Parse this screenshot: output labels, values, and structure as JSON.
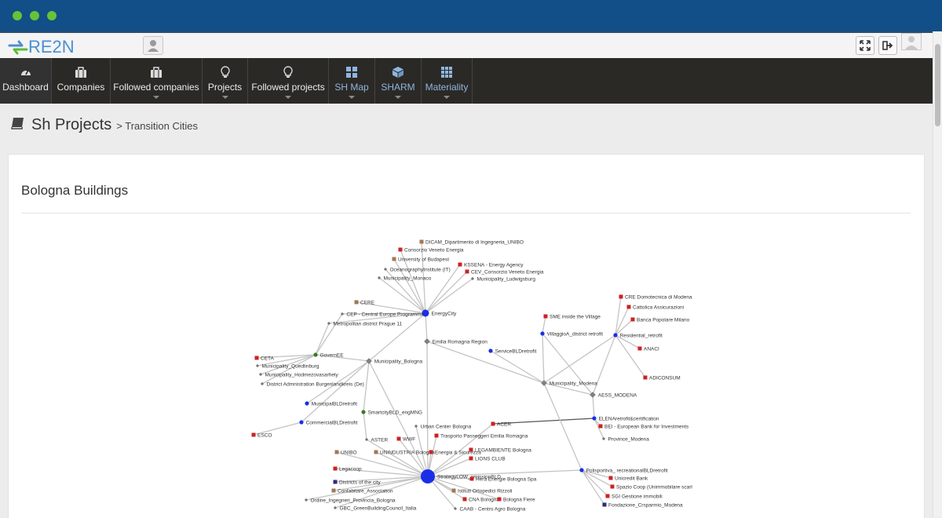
{
  "app": {
    "logo_text": "RE2N"
  },
  "nav": [
    {
      "label": "Dashboard",
      "icon": "dashboard-icon",
      "caret": false
    },
    {
      "label": "Companies",
      "icon": "briefcase-icon",
      "caret": false
    },
    {
      "label": "Followed companies",
      "icon": "briefcase-icon",
      "caret": true
    },
    {
      "label": "Projects",
      "icon": "lightbulb-icon",
      "caret": true
    },
    {
      "label": "Followed projects",
      "icon": "lightbulb-icon",
      "caret": true
    },
    {
      "label": "SH Map",
      "icon": "grid-icon",
      "caret": true
    },
    {
      "label": "SHARM",
      "icon": "cube-icon",
      "caret": true
    },
    {
      "label": "Materiality",
      "icon": "grid-icon",
      "caret": true
    }
  ],
  "breadcrumb": {
    "title": "Sh Projects",
    "sub": "> Transition Cities"
  },
  "panel": {
    "title": "Bologna Buildings"
  },
  "colors": {
    "titlebar": "#124e87",
    "nav": "#2b2926",
    "blue_node": "#1a2ee8",
    "red": "#cc2222",
    "brown": "#a07858",
    "gray": "#777777",
    "green": "#3a7a2a",
    "navy": "#2c2c7a"
  },
  "graph": {
    "nodes": [
      {
        "id": "DICAM_Dipartimento di Ingegneria_UNIBO",
        "type": "brown"
      },
      {
        "id": "Consorzio Veneto Energia",
        "type": "red"
      },
      {
        "id": "University of Budapest",
        "type": "brown"
      },
      {
        "id": "OceanographyInstitute (IT)",
        "type": "gray"
      },
      {
        "id": "Municipality_Monaco",
        "type": "gray"
      },
      {
        "id": "KSSENA - Energy Agency",
        "type": "red"
      },
      {
        "id": "CEV_Consorzio Veneto Energia",
        "type": "red"
      },
      {
        "id": "Municipality_Ludwigsburg",
        "type": "gray"
      },
      {
        "id": "EnergyCity",
        "type": "bluebig"
      },
      {
        "id": "CERE",
        "type": "brown"
      },
      {
        "id": "CEP - Central Europe Programme",
        "type": "gray"
      },
      {
        "id": "Metropolitan district Prague 11",
        "type": "gray"
      },
      {
        "id": "Emilia Romagna Region",
        "type": "graybig"
      },
      {
        "id": "ServiceBLDretrofit",
        "type": "blue"
      },
      {
        "id": "GovernEE",
        "type": "green"
      },
      {
        "id": "CETA",
        "type": "red"
      },
      {
        "id": "Municipality_Quedlinburg",
        "type": "gray"
      },
      {
        "id": "Municipality_Hodmezovasarhely",
        "type": "gray"
      },
      {
        "id": "District Admnistration Burgenlandkreis (De)",
        "type": "gray"
      },
      {
        "id": "Municipality_Bologna",
        "type": "graybig"
      },
      {
        "id": "MunicipalBLDretrofit",
        "type": "blue"
      },
      {
        "id": "SmartcityBLD_engMNG",
        "type": "green"
      },
      {
        "id": "CommercialBLDretrofit",
        "type": "blue"
      },
      {
        "id": "ESCO",
        "type": "red"
      },
      {
        "id": "ASTER",
        "type": "gray"
      },
      {
        "id": "WWF",
        "type": "red"
      },
      {
        "id": "Urban Center Bologna",
        "type": "gray"
      },
      {
        "id": "Trasporto Passeggeri Emilia Romagna",
        "type": "red"
      },
      {
        "id": "ACER",
        "type": "red"
      },
      {
        "id": "UNIBO",
        "type": "brown"
      },
      {
        "id": "UNINDUSTRIA Bologna",
        "type": "brown"
      },
      {
        "id": "Energia & Sicurezza",
        "type": "red"
      },
      {
        "id": "LEGAMBIENTE Bologna",
        "type": "red"
      },
      {
        "id": "LIONS CLUB",
        "type": "red"
      },
      {
        "id": "Legacoop",
        "type": "red"
      },
      {
        "id": "StrategyLOW_emissionBLD",
        "type": "bluehuge"
      },
      {
        "id": "Districts of the city",
        "type": "navy"
      },
      {
        "id": "Confabitare_Association",
        "type": "brown"
      },
      {
        "id": "Ordine_Ingegneri_Provincia_Bologna",
        "type": "gray"
      },
      {
        "id": "GBC_GreenBuildingCouncil_Italia",
        "type": "gray"
      },
      {
        "id": "Hera Energie Bologna Spa",
        "type": "red"
      },
      {
        "id": "Istituti Ortopedici Rizzoli",
        "type": "brown"
      },
      {
        "id": "CNA Bologna",
        "type": "red"
      },
      {
        "id": "Bologna Fiere",
        "type": "red"
      },
      {
        "id": "CAAB - Centro Agro Bologna",
        "type": "gray"
      },
      {
        "id": "SME inside the Village",
        "type": "red"
      },
      {
        "id": "VillaggioA_district retrofit",
        "type": "blue"
      },
      {
        "id": "CRE Domotecnica di Modena",
        "type": "red"
      },
      {
        "id": "Cattolica Assicurazioni",
        "type": "red"
      },
      {
        "id": "Banca Popolare Milano",
        "type": "red"
      },
      {
        "id": "Residential_retrofit",
        "type": "blue"
      },
      {
        "id": "ANACI",
        "type": "red"
      },
      {
        "id": "ADICONSUM",
        "type": "red"
      },
      {
        "id": "Municipality_Modena",
        "type": "graybig"
      },
      {
        "id": "AESS_MODENA",
        "type": "graybig"
      },
      {
        "id": "ELENAretrofit&certification",
        "type": "blue"
      },
      {
        "id": "BEI - European Bank for Investments",
        "type": "red"
      },
      {
        "id": "Province_Modena",
        "type": "gray"
      },
      {
        "id": "Polisportiva_ recreationalBLDretrofit",
        "type": "blue"
      },
      {
        "id": "Unicredit Bank",
        "type": "red"
      },
      {
        "id": "Spazio Coop (Unimmobilare scarl",
        "type": "red"
      },
      {
        "id": "SGI Gestione immobili",
        "type": "red"
      },
      {
        "id": "Fondazione_Crsparmio_Modena",
        "type": "navy"
      }
    ],
    "edges": [
      [
        "DICAM_Dipartimento di Ingegneria_UNIBO",
        "EnergyCity"
      ],
      [
        "Consorzio Veneto Energia",
        "EnergyCity"
      ],
      [
        "University of Budapest",
        "EnergyCity"
      ],
      [
        "OceanographyInstitute (IT)",
        "EnergyCity"
      ],
      [
        "Municipality_Monaco",
        "EnergyCity"
      ],
      [
        "KSSENA - Energy Agency",
        "EnergyCity"
      ],
      [
        "CEV_Consorzio Veneto Energia",
        "EnergyCity"
      ],
      [
        "Municipality_Ludwigsburg",
        "EnergyCity"
      ],
      [
        "CERE",
        "EnergyCity"
      ],
      [
        "CEP - Central Europe Programme",
        "EnergyCity"
      ],
      [
        "Metropolitan district Prague 11",
        "EnergyCity"
      ],
      [
        "Municipality_Bologna",
        "EnergyCity"
      ],
      [
        "Emilia Romagna Region",
        "EnergyCity"
      ],
      [
        "Emilia Romagna Region",
        "StrategyLOW_emissionBLD"
      ],
      [
        "Emilia Romagna Region",
        "Municipality_Modena"
      ],
      [
        "ServiceBLDretrofit",
        "Municipality_Modena"
      ],
      [
        "CEP - Central Europe Programme",
        "GovernEE"
      ],
      [
        "Metropolitan district Prague 11",
        "GovernEE"
      ],
      [
        "CETA",
        "GovernEE"
      ],
      [
        "Municipality_Quedlinburg",
        "GovernEE"
      ],
      [
        "Municipality_Hodmezovasarhely",
        "GovernEE"
      ],
      [
        "District Admnistration Burgenlandkreis (De)",
        "GovernEE"
      ],
      [
        "Municipality_Bologna",
        "GovernEE"
      ],
      [
        "Municipality_Bologna",
        "MunicipalBLDretrofit"
      ],
      [
        "Municipality_Bologna",
        "SmartcityBLD_engMNG"
      ],
      [
        "Municipality_Bologna",
        "StrategyLOW_emissionBLD"
      ],
      [
        "Municipality_Bologna",
        "CommercialBLDretrofit"
      ],
      [
        "SmartcityBLD_engMNG",
        "ASTER"
      ],
      [
        "ESCO",
        "CommercialBLDretrofit"
      ],
      [
        "ACER",
        "ELENAretrofit&certification"
      ],
      [
        "WWF",
        "StrategyLOW_emissionBLD"
      ],
      [
        "Urban Center Bologna",
        "StrategyLOW_emissionBLD"
      ],
      [
        "Trasporto Passeggeri Emilia Romagna",
        "StrategyLOW_emissionBLD"
      ],
      [
        "ACER",
        "StrategyLOW_emissionBLD"
      ],
      [
        "ASTER",
        "StrategyLOW_emissionBLD"
      ],
      [
        "UNIBO",
        "StrategyLOW_emissionBLD"
      ],
      [
        "UNINDUSTRIA Bologna",
        "StrategyLOW_emissionBLD"
      ],
      [
        "Energia & Sicurezza",
        "StrategyLOW_emissionBLD"
      ],
      [
        "LEGAMBIENTE Bologna",
        "StrategyLOW_emissionBLD"
      ],
      [
        "LIONS CLUB",
        "StrategyLOW_emissionBLD"
      ],
      [
        "Legacoop",
        "StrategyLOW_emissionBLD"
      ],
      [
        "Districts of the city",
        "StrategyLOW_emissionBLD"
      ],
      [
        "Confabitare_Association",
        "StrategyLOW_emissionBLD"
      ],
      [
        "Ordine_Ingegneri_Provincia_Bologna",
        "StrategyLOW_emissionBLD"
      ],
      [
        "GBC_GreenBuildingCouncil_Italia",
        "StrategyLOW_emissionBLD"
      ],
      [
        "Hera Energie Bologna Spa",
        "StrategyLOW_emissionBLD"
      ],
      [
        "Istituti Ortopedici Rizzoli",
        "StrategyLOW_emissionBLD"
      ],
      [
        "CNA Bologna",
        "StrategyLOW_emissionBLD"
      ],
      [
        "Bologna Fiere",
        "StrategyLOW_emissionBLD"
      ],
      [
        "CAAB - Centro Agro Bologna",
        "StrategyLOW_emissionBLD"
      ],
      [
        "Polisportiva_ recreationalBLDretrofit",
        "StrategyLOW_emissionBLD"
      ],
      [
        "SME inside the Village",
        "VillaggioA_district retrofit"
      ],
      [
        "VillaggioA_district retrofit",
        "Municipality_Modena"
      ],
      [
        "VillaggioA_district retrofit",
        "AESS_MODENA"
      ],
      [
        "CRE Domotecnica di Modena",
        "Residential_retrofit"
      ],
      [
        "Cattolica Assicurazioni",
        "Residential_retrofit"
      ],
      [
        "Banca Popolare Milano",
        "Residential_retrofit"
      ],
      [
        "ANACI",
        "Residential_retrofit"
      ],
      [
        "ADICONSUM",
        "Residential_retrofit"
      ],
      [
        "Residential_retrofit",
        "Municipality_Modena"
      ],
      [
        "Residential_retrofit",
        "AESS_MODENA"
      ],
      [
        "Municipality_Modena",
        "AESS_MODENA"
      ],
      [
        "Municipality_Modena",
        "Polisportiva_ recreationalBLDretrofit"
      ],
      [
        "AESS_MODENA",
        "ELENAretrofit&certification"
      ],
      [
        "ELENAretrofit&certification",
        "BEI - European Bank for Investments"
      ],
      [
        "ELENAretrofit&certification",
        "Province_Modena"
      ],
      [
        "Polisportiva_ recreationalBLDretrofit",
        "Unicredit Bank"
      ],
      [
        "Polisportiva_ recreationalBLDretrofit",
        "Spazio Coop (Unimmobilare scarl"
      ],
      [
        "Polisportiva_ recreationalBLDretrofit",
        "SGI Gestione immobili"
      ],
      [
        "Polisportiva_ recreationalBLDretrofit",
        "Fondazione_Crsparmio_Modena"
      ]
    ]
  }
}
